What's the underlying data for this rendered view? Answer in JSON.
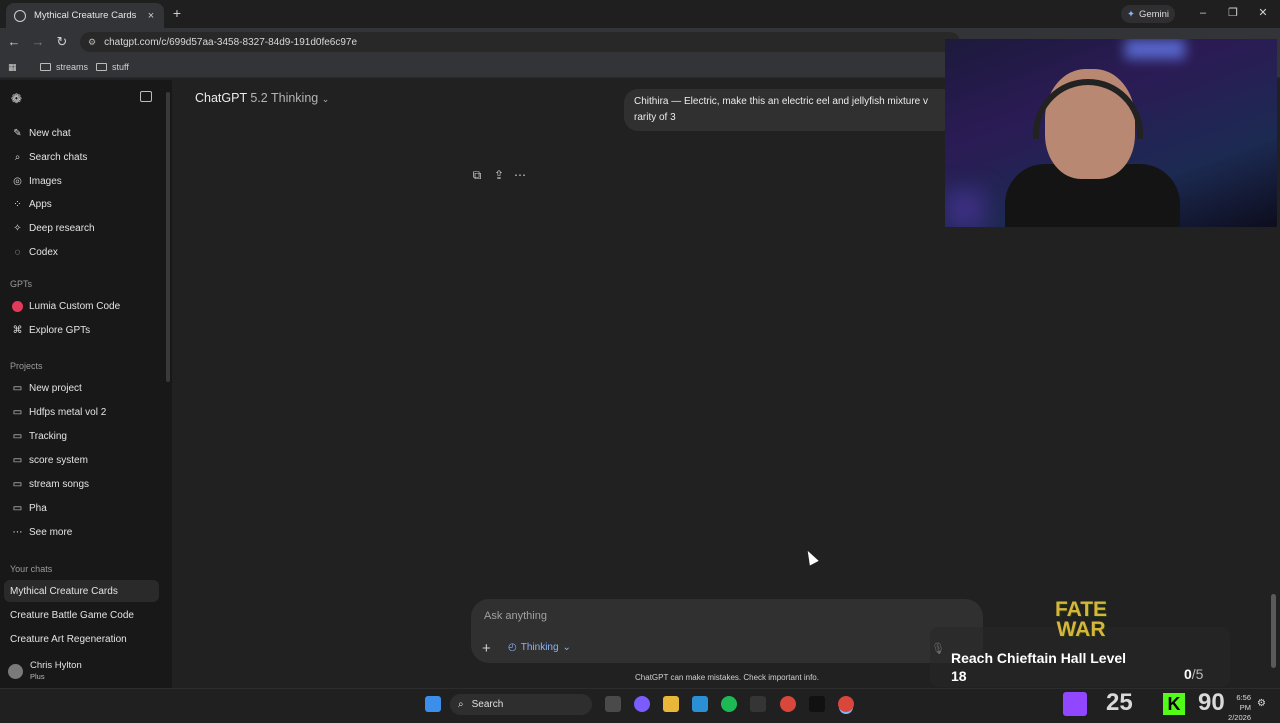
{
  "browser": {
    "tab_title": "Mythical Creature Cards",
    "new_tab": "+",
    "tab_close": "×",
    "gemini_label": "Gemini",
    "url": "chatgpt.com/c/699d57aa-3458-8327-84d9-191d0fe6c97e",
    "bookmarks": [
      "streams",
      "stuff"
    ]
  },
  "sidebar": {
    "items": [
      {
        "label": "New chat",
        "icon": "new-chat-icon"
      },
      {
        "label": "Search chats",
        "icon": "search-icon"
      },
      {
        "label": "Images",
        "icon": "images-icon"
      },
      {
        "label": "Apps",
        "icon": "apps-icon"
      },
      {
        "label": "Deep research",
        "icon": "deep-research-icon"
      },
      {
        "label": "Codex",
        "icon": "codex-icon"
      }
    ],
    "gpts_heading": "GPTs",
    "gpts": [
      {
        "label": "Lumia Custom Code",
        "icon": "lumia-icon"
      },
      {
        "label": "Explore GPTs",
        "icon": "explore-icon"
      }
    ],
    "projects_heading": "Projects",
    "projects": [
      {
        "label": "New project",
        "icon": "new-folder-icon"
      },
      {
        "label": "Hdfps metal vol 2",
        "icon": "folder-icon"
      },
      {
        "label": "Tracking",
        "icon": "folder-icon"
      },
      {
        "label": "score system",
        "icon": "folder-icon"
      },
      {
        "label": "stream songs",
        "icon": "folder-icon"
      },
      {
        "label": "Pha",
        "icon": "folder-icon"
      },
      {
        "label": "See more",
        "icon": "ellipsis-icon"
      }
    ],
    "chats_heading": "Your chats",
    "chats": [
      "Mythical Creature Cards",
      "Creature Battle Game Code",
      "Creature Art Regeneration"
    ],
    "user": {
      "name": "Chris Hylton",
      "plan": "Plus"
    }
  },
  "main": {
    "model_name": "ChatGPT",
    "model_version": "5.2 Thinking",
    "user_message_line1": "Chithira — Electric, make this an electric eel and jellyfish mixture v",
    "user_message_line2": "rarity of 3",
    "composer_placeholder": "Ask anything",
    "thinking_label": "Thinking",
    "disclaimer": "ChatGPT can make mistakes. Check important info."
  },
  "overlay": {
    "game_logo_line1": "FATE",
    "game_logo_line2": "WAR",
    "goal_text": "Reach Chieftain Hall Level 18",
    "goal_current": "0",
    "goal_total": "/5",
    "twitch_count": "25",
    "kick_count": "90",
    "kick_letter": "K"
  },
  "taskbar": {
    "search_label": "Search",
    "time": "6:56 PM",
    "date": "2/2026"
  },
  "colors": {
    "accent_blue": "#8ab4f8",
    "sidebar_bg": "#181818",
    "main_bg": "#212121",
    "twitch": "#9146ff",
    "kick": "#53fc18"
  }
}
